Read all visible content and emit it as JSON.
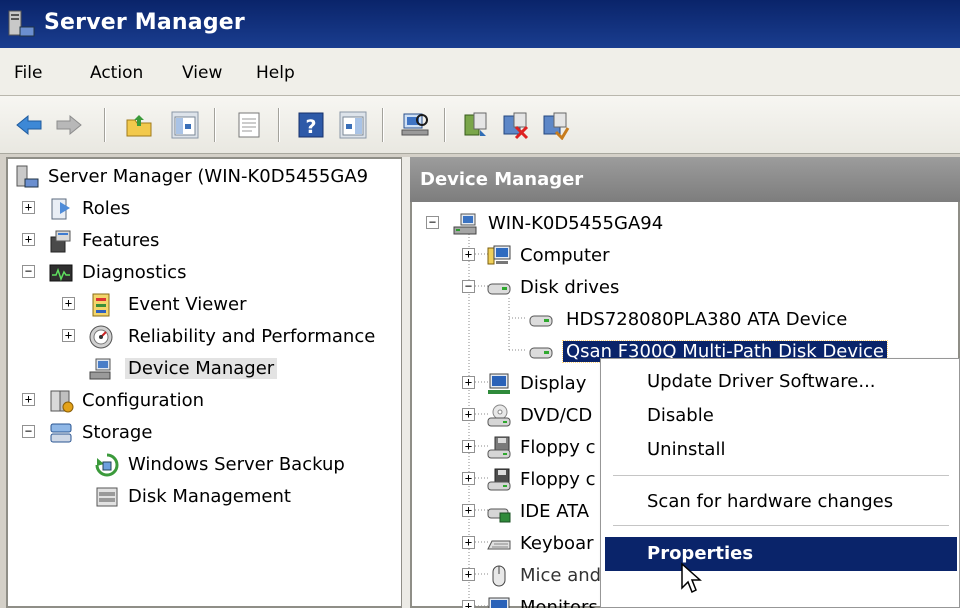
{
  "window": {
    "title": "Server Manager"
  },
  "menu": [
    "File",
    "Action",
    "View",
    "Help"
  ],
  "toolbar": {
    "icons": [
      "back-arrow-icon",
      "forward-arrow-icon",
      "up-folder-icon",
      "show-hide-tree-icon",
      "properties-icon",
      "help-icon",
      "action-pane-icon",
      "scan-hardware-icon",
      "update-driver-icon",
      "uninstall-icon",
      "disable-icon"
    ]
  },
  "left_tree": {
    "root": "Server Manager (WIN-K0D5455GA9",
    "roles": "Roles",
    "features": "Features",
    "diagnostics": "Diagnostics",
    "event_viewer": "Event Viewer",
    "reliability": "Reliability and Performance",
    "device_manager": "Device Manager",
    "configuration": "Configuration",
    "storage": "Storage",
    "windows_server_backup": "Windows Server Backup",
    "disk_management": "Disk Management"
  },
  "right_pane": {
    "title": "Device Manager",
    "root": "WIN-K0D5455GA94",
    "computer": "Computer",
    "disk_drives": "Disk drives",
    "disk1": "HDS728080PLA380 ATA Device",
    "disk2": "Qsan F300Q Multi-Path Disk Device",
    "display": "Display",
    "dvd": "DVD/CD",
    "floppy1": "Floppy c",
    "floppy2": "Floppy c",
    "ide": "IDE ATA",
    "keyboards": "Keyboar",
    "mice": "Mice and other pointing devices",
    "monitors": "Monitors"
  },
  "context_menu": {
    "update_driver": "Update Driver Software...",
    "disable": "Disable",
    "uninstall": "Uninstall",
    "scan": "Scan for hardware changes",
    "properties": "Properties"
  },
  "colors": {
    "title_bar": "#0a246a",
    "selection": "#0a246a",
    "header": "#8a8a8a"
  }
}
